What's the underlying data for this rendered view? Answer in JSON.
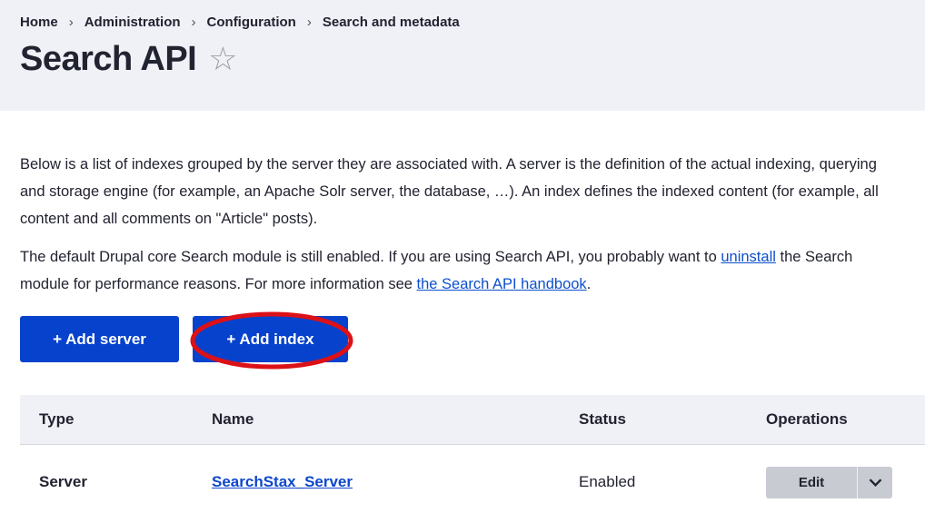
{
  "breadcrumb": {
    "separator": "›",
    "items": [
      "Home",
      "Administration",
      "Configuration",
      "Search and metadata"
    ]
  },
  "page": {
    "title": "Search API",
    "star_icon": "☆"
  },
  "intro": {
    "p1_lines": [
      "Below is a list of indexes grouped by the server they are associated with. A server is the definition of the actual indexing, querying",
      "and storage engine (for example, an Apache Solr server, the database, …). An index defines the indexed content (for example, all",
      "content and all comments on \"Article\" posts)."
    ],
    "p2_line1_pre": "The default Drupal core Search module is still enabled. If you are using Search API, you probably want to ",
    "p2_line1_link": "uninstall",
    "p2_line1_post": " the Search",
    "p2_line2_pre": "module for performance reasons. For more information see ",
    "p2_line2_link": "the Search API handbook",
    "p2_line2_post": "."
  },
  "actions": {
    "add_server_label": "+ Add server",
    "add_index_label": "+ Add index"
  },
  "annotation": {
    "type": "ellipse",
    "color": "#dc1118",
    "target": "add-index-button"
  },
  "table": {
    "headers": [
      "Type",
      "Name",
      "Status",
      "Operations"
    ],
    "rows": [
      {
        "type": "Server",
        "name": "SearchStax_Server",
        "status": "Enabled",
        "operations_label": "Edit"
      }
    ]
  },
  "colors": {
    "primary_button": "#0642cc",
    "link": "#0d50cc",
    "header_band": "#f0f1f7",
    "dropbutton_bg": "#c9cbd3",
    "annotation_red": "#dc1118",
    "text": "#222330"
  }
}
